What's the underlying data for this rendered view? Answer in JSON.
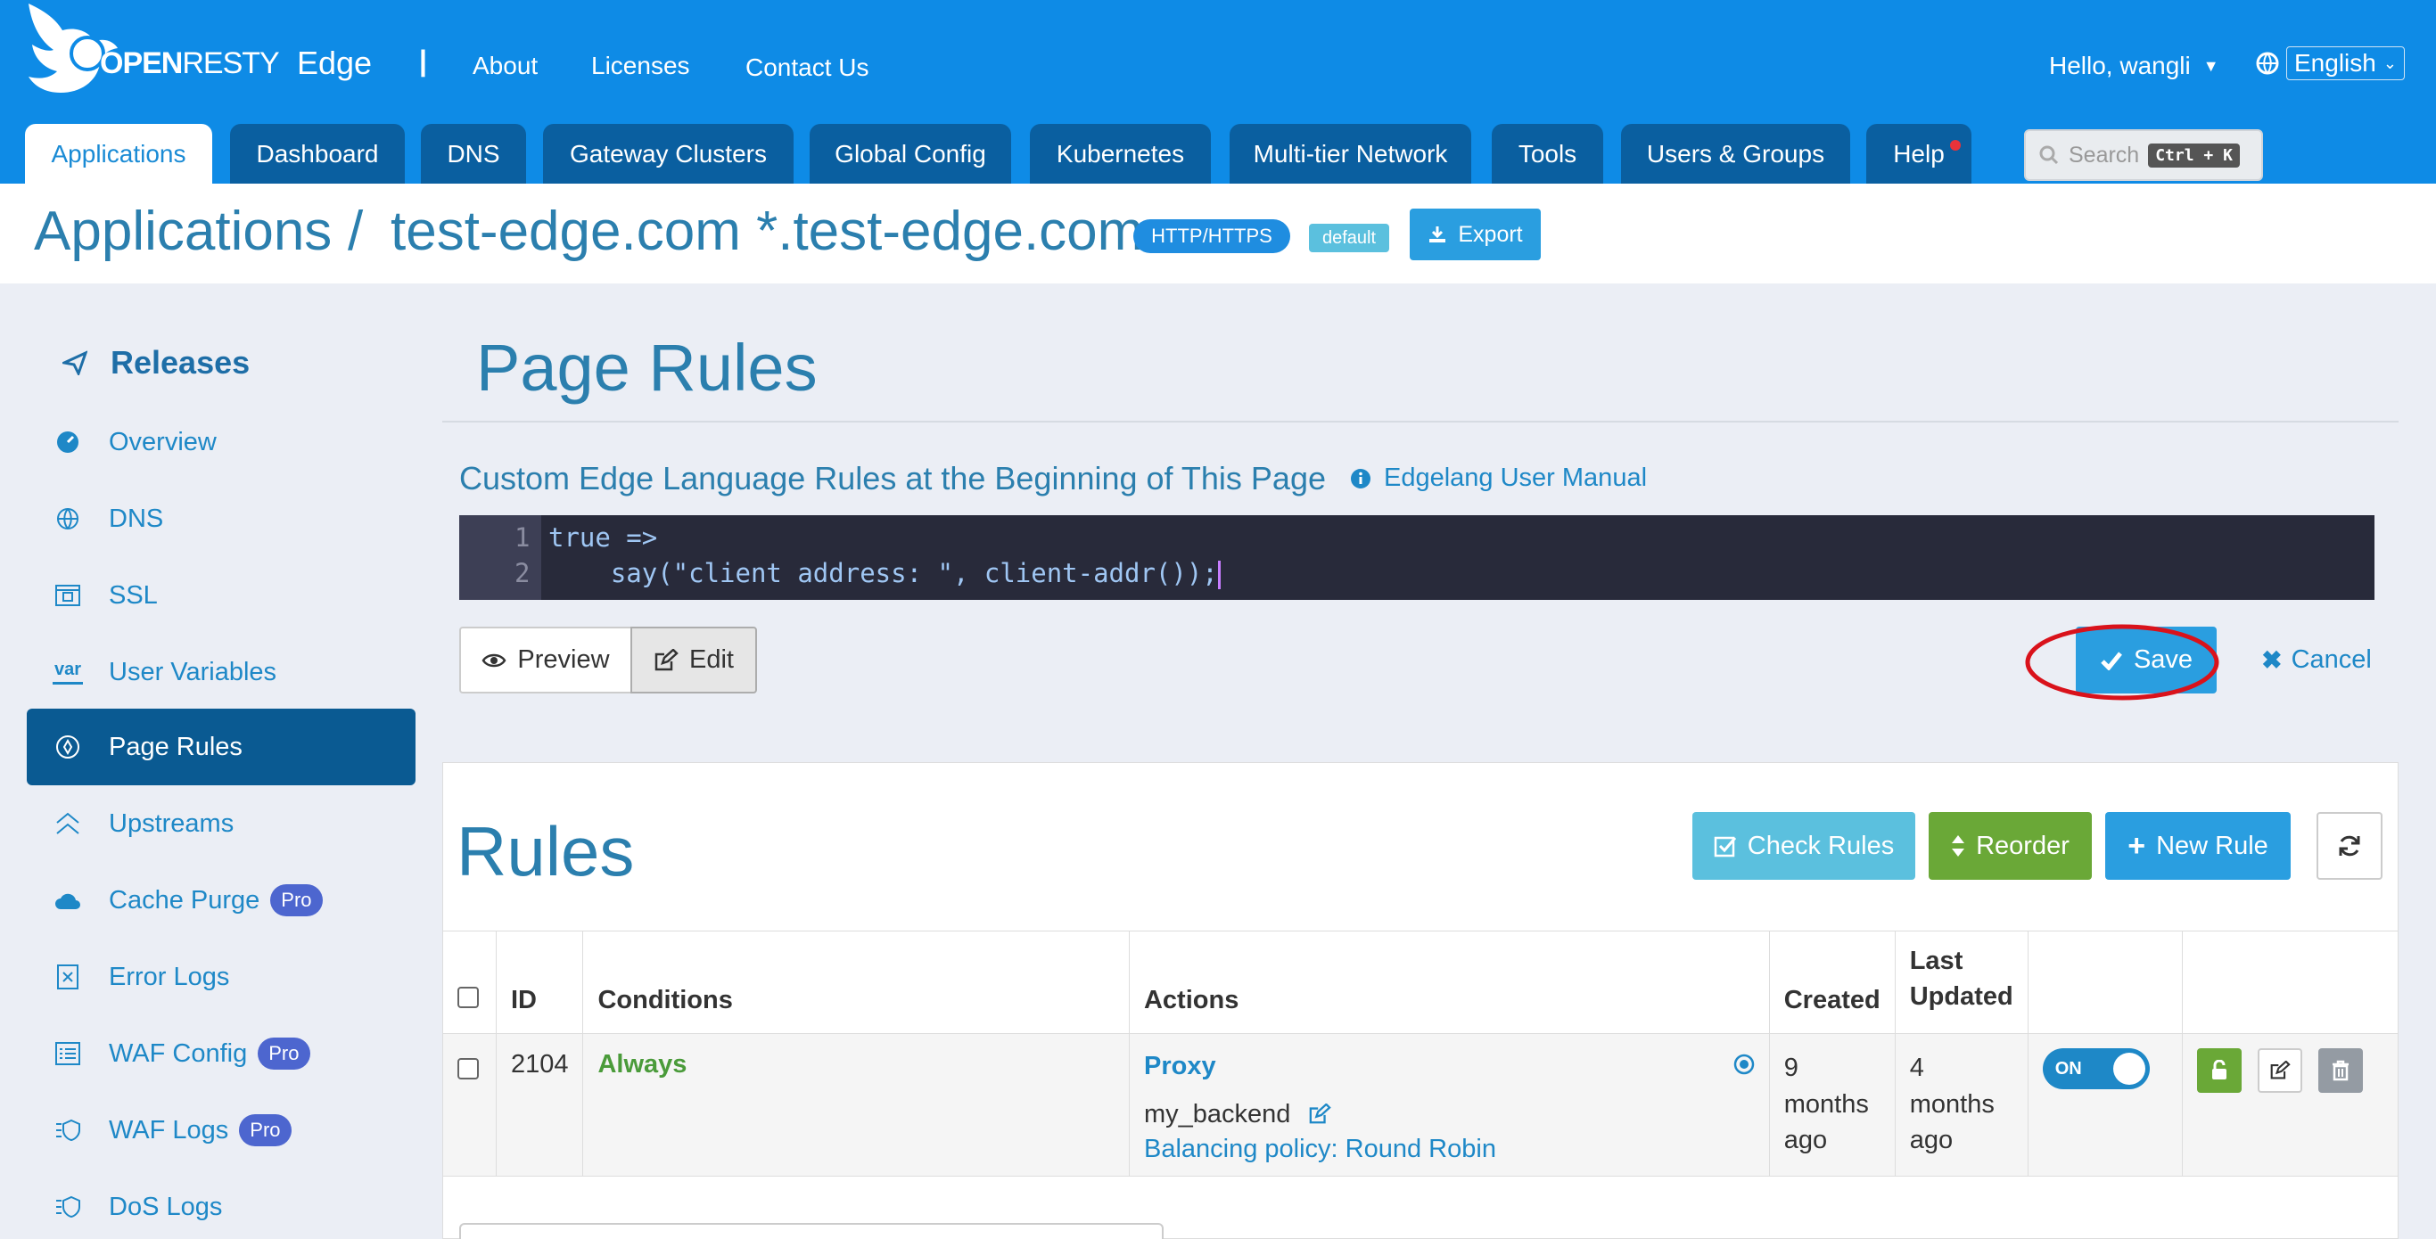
{
  "topbar": {
    "logo_text_a": "OPEN",
    "logo_text_b": "RESTY",
    "logo_edge": "Edge",
    "divider": "|",
    "links": [
      "About",
      "Licenses",
      "Contact Us"
    ],
    "user": "Hello, wangli",
    "language": "English",
    "search_placeholder": "Search",
    "search_shortcut": "Ctrl + K"
  },
  "tabs": [
    "Applications",
    "Dashboard",
    "DNS",
    "Gateway Clusters",
    "Global Config",
    "Kubernetes",
    "Multi-tier Network",
    "Tools",
    "Users & Groups",
    "Help"
  ],
  "breadcrumb": {
    "root": "Applications",
    "sep": "/",
    "app": "test-edge.com *.test-edge.com",
    "protocol_badge": "HTTP/HTTPS",
    "partition_badge": "default",
    "export_label": "Export"
  },
  "sidebar": {
    "heading": "Releases",
    "items": [
      {
        "label": "Overview",
        "pro": ""
      },
      {
        "label": "DNS",
        "pro": ""
      },
      {
        "label": "SSL",
        "pro": ""
      },
      {
        "label": "User Variables",
        "pro": ""
      },
      {
        "label": "Page Rules",
        "pro": ""
      },
      {
        "label": "Upstreams",
        "pro": ""
      },
      {
        "label": "Cache Purge",
        "pro": "Pro"
      },
      {
        "label": "Error Logs",
        "pro": ""
      },
      {
        "label": "WAF Config",
        "pro": "Pro"
      },
      {
        "label": "WAF Logs",
        "pro": "Pro"
      },
      {
        "label": "DoS Logs",
        "pro": ""
      }
    ],
    "var_icon_text": "var"
  },
  "main": {
    "page_title": "Page Rules",
    "custom_heading": "Custom Edge Language Rules at the Beginning of This Page",
    "manual_link": "Edgelang User Manual",
    "code_lines": [
      {
        "num": "1",
        "text": "true =>"
      },
      {
        "num": "2",
        "text": "    say(\"client address: \", client-addr());"
      }
    ],
    "preview_label": "Preview",
    "edit_label": "Edit",
    "save_label": "Save",
    "cancel_label": "Cancel",
    "rules_title": "Rules",
    "check_rules_label": "Check Rules",
    "reorder_label": "Reorder",
    "new_rule_label": "New Rule"
  },
  "table": {
    "headers": {
      "id": "ID",
      "conditions": "Conditions",
      "actions": "Actions",
      "created": "Created",
      "updated_1": "Last",
      "updated_2": "Updated"
    },
    "rows": [
      {
        "id": "2104",
        "condition": "Always",
        "action_title": "Proxy",
        "backend": "my_backend",
        "policy": "Balancing policy: Round Robin",
        "created_1": "9",
        "created_2": "months",
        "created_3": "ago",
        "updated_1": "4",
        "updated_2": "months",
        "updated_3": "ago",
        "toggle": "ON"
      }
    ]
  },
  "colors": {
    "topbar": "#0e8be6",
    "tab_dark": "#0a5fa0",
    "link": "#1e88c7",
    "save": "#2a9ee0",
    "check": "#5bc0de",
    "reorder": "#6aa837",
    "highlight_circle": "#d9121b"
  }
}
